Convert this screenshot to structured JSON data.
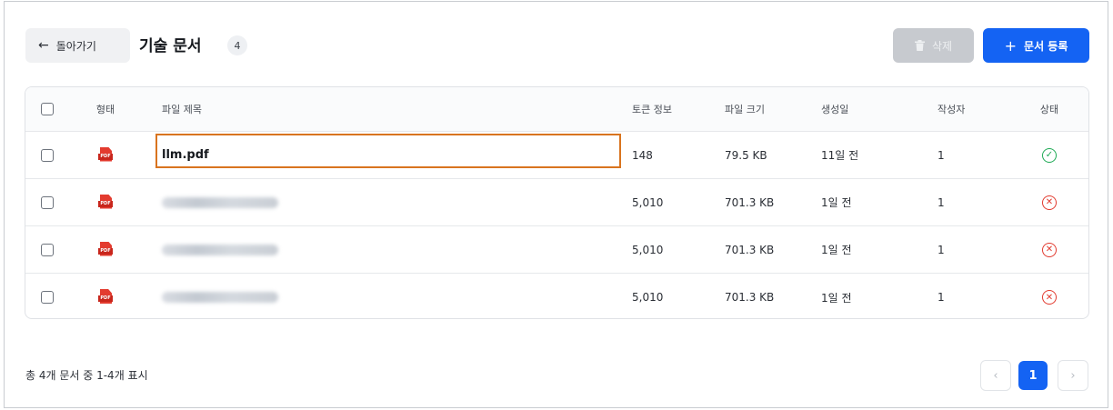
{
  "header": {
    "back_label": "돌아가기",
    "back_arrow": "←",
    "title": "기술 문서",
    "count": "4",
    "delete_label": "삭제",
    "add_label": "문서 등록",
    "add_plus": "+"
  },
  "table": {
    "columns": {
      "type": "형태",
      "title": "파일 제목",
      "tokens": "토큰 정보",
      "size": "파일 크기",
      "created": "생성일",
      "author": "작성자",
      "status": "상태"
    },
    "rows": [
      {
        "icon": "pdf-icon",
        "icon_text": "PDF",
        "title": "llm.pdf",
        "tokens": "148",
        "size": "79.5 KB",
        "created": "11일 전",
        "author": "1",
        "status": "success"
      },
      {
        "icon": "pdf-icon",
        "icon_text": "PDF",
        "title": "",
        "tokens": "5,010",
        "size": "701.3 KB",
        "created": "1일 전",
        "author": "1",
        "status": "error"
      },
      {
        "icon": "pdf-icon",
        "icon_text": "PDF",
        "title": "",
        "tokens": "5,010",
        "size": "701.3 KB",
        "created": "1일 전",
        "author": "1",
        "status": "error"
      },
      {
        "icon": "pdf-icon",
        "icon_text": "PDF",
        "title": "",
        "tokens": "5,010",
        "size": "701.3 KB",
        "created": "1일 전",
        "author": "1",
        "status": "error"
      }
    ]
  },
  "footer": {
    "summary": "총 4개 문서 중 1-4개 표시",
    "prev": "‹",
    "current_page": "1",
    "next": "›"
  },
  "colors": {
    "primary": "#1463f3",
    "disabled": "#c7cacf",
    "success": "#1faa55",
    "error": "#e23a2f",
    "selection": "#d9741f"
  }
}
